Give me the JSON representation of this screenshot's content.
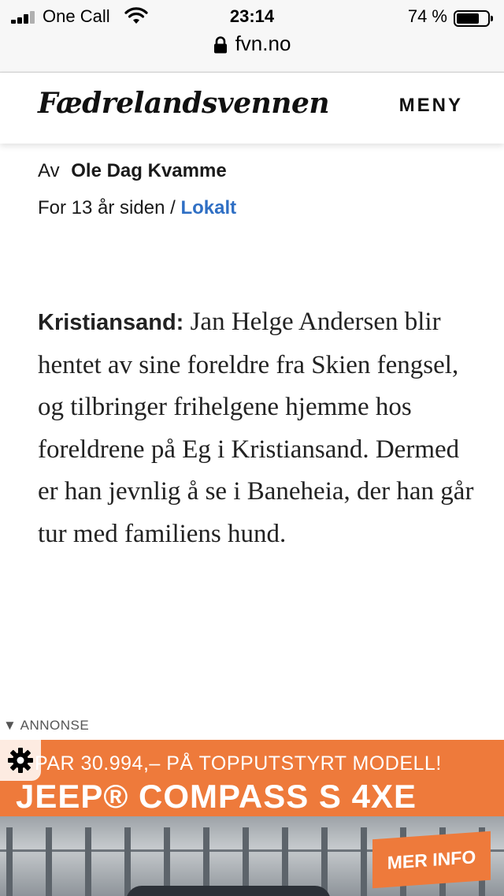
{
  "status_bar": {
    "carrier": "One Call",
    "time": "23:14",
    "battery_percent": "74 %",
    "battery_level": 0.74,
    "icons": [
      "signal-icon",
      "wifi-icon",
      "battery-icon"
    ]
  },
  "browser": {
    "url": "fvn.no",
    "icon": "lock-icon"
  },
  "header": {
    "logo": "Fædrelandsvennen",
    "menu_label": "MENY"
  },
  "article": {
    "byline_prefix": "Av",
    "author": "Ole Dag Kvamme",
    "timestamp": "For 13 år siden",
    "separator": " / ",
    "category": "Lokalt",
    "category_color": "#2f6fc4",
    "place": "Kristiansand:",
    "body": "Jan Helge Andersen blir hentet av sine foreldre fra Skien fengsel, og tilbringer frihelgene hjemme hos foreldrene på Eg i Kristiansand. Dermed er han jevnlig å se i Baneheia, der han går tur med familiens hund."
  },
  "ad": {
    "label": "▼ ANNONSE",
    "headline_small": "PAR 30.994,– PÅ TOPPUTSTYRT MODELL!",
    "headline_big": "JEEP® COMPASS S 4XE",
    "cta": "MER INFO",
    "accent_color": "#ee7a3b",
    "icon": "gear-icon"
  }
}
